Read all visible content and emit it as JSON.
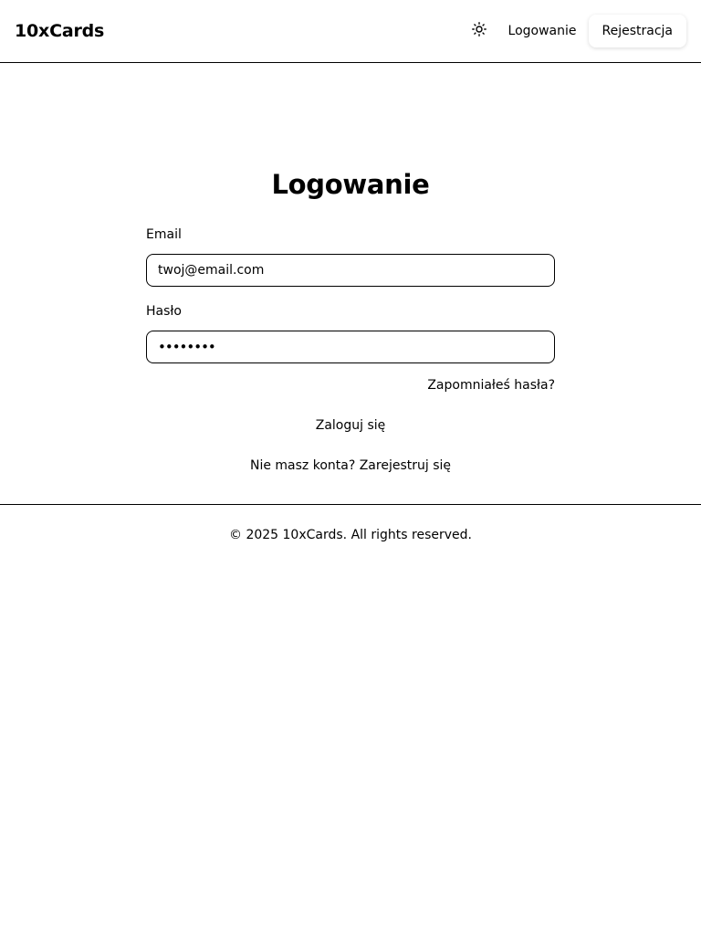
{
  "header": {
    "brand": "10xCards",
    "theme_icon": "sun-icon",
    "login_label": "Logowanie",
    "register_label": "Rejestracja"
  },
  "main": {
    "title": "Logowanie",
    "email_label": "Email",
    "email_value": "twoj@email.com",
    "password_label": "Hasło",
    "password_value": "••••••••",
    "forgot_label": "Zapomniałeś hasła?",
    "submit_label": "Zaloguj się",
    "no_account_label": "Nie masz konta? Zarejestruj się"
  },
  "footer": {
    "copyright": "© 2025 10xCards. All rights reserved."
  }
}
